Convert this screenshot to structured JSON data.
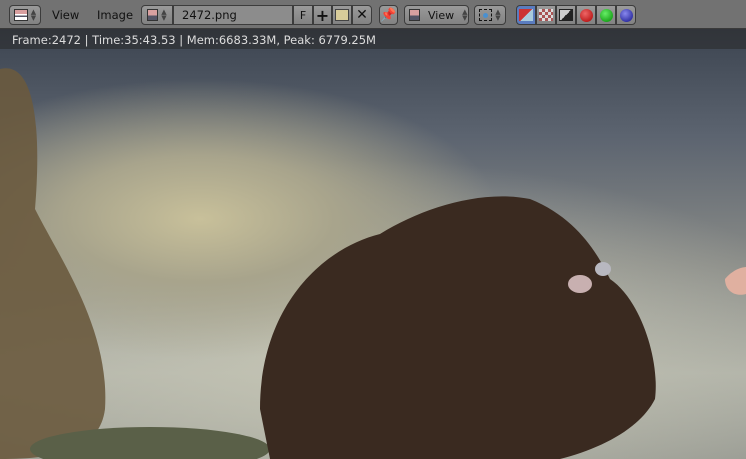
{
  "header": {
    "editor_type_icon": "image-editor-icon",
    "menus": [
      "View",
      "Image"
    ],
    "image_name": "2472.png",
    "fake_user_label": "F",
    "new_icon": "plus-icon",
    "open_icon": "open-folder-icon",
    "unlink_icon": "close-icon",
    "pin_icon": "pin-icon",
    "mode_select": "View",
    "pivot_icon": "pivot-icon",
    "draw_channels": [
      "color-alpha-icon",
      "alpha-icon",
      "z-buffer-icon",
      "red-channel-icon",
      "green-channel-icon",
      "blue-channel-icon"
    ]
  },
  "status": {
    "text": "Frame:2472 | Time:35:43.53 | Mem:6683.33M, Peak: 6779.25M"
  },
  "colors": {
    "header": "#727272",
    "active_toggle": "#5a7cbf"
  }
}
